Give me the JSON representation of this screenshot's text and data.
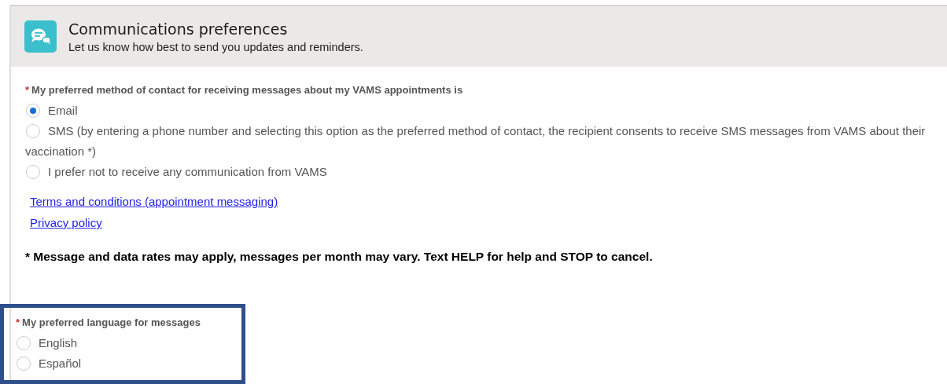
{
  "header": {
    "title": "Communications preferences",
    "subtitle": "Let us know how best to send you updates and reminders."
  },
  "contact_method": {
    "label": "My preferred method of contact for receiving messages about my VAMS appointments is",
    "required_mark": "*",
    "options": [
      {
        "label": "Email",
        "selected": true
      },
      {
        "label": "SMS (by entering a phone number and selecting this option as the preferred method of contact, the recipient consents to receive SMS messages from VAMS about their vaccination *)",
        "selected": false
      },
      {
        "label": "I prefer not to receive any communication from VAMS",
        "selected": false
      }
    ]
  },
  "links": [
    "Terms and conditions (appointment messaging)",
    "Privacy policy"
  ],
  "note": "* Message and data rates may apply, messages per month may vary. Text HELP for help and STOP to cancel.",
  "language": {
    "label": "My preferred language for messages",
    "required_mark": "*",
    "highlighted": true,
    "options": [
      {
        "label": "English",
        "selected": false
      },
      {
        "label": "Español",
        "selected": false
      }
    ]
  }
}
